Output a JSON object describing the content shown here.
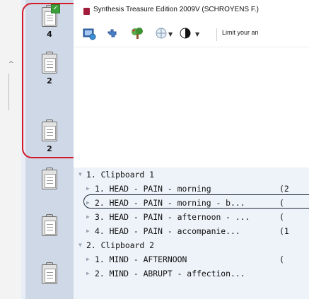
{
  "window": {
    "title": "Synthesis Treasure Edition 2009V (SCHROYENS F.)"
  },
  "toolbar": {
    "limit_text": "Limit your an",
    "icons": [
      "screen-icon",
      "puzzle-icon",
      "tree-icon",
      "globe-icon",
      "half-moon-icon"
    ]
  },
  "clipboards": [
    {
      "count": "4",
      "icon": "clipboard-checked-icon"
    },
    {
      "count": "2",
      "icon": "clipboard-icon"
    },
    {
      "count": "2",
      "icon": "clipboard-icon"
    },
    {
      "count": "",
      "icon": "clipboard-icon"
    },
    {
      "count": "",
      "icon": "clipboard-icon"
    },
    {
      "count": "",
      "icon": "clipboard-icon"
    }
  ],
  "tree": {
    "groups": [
      {
        "label": "1. Clipboard 1",
        "items": [
          {
            "label": "1. HEAD - PAIN - morning",
            "count": "(2"
          },
          {
            "label": "2. HEAD - PAIN - morning - b...",
            "count": "("
          },
          {
            "label": "3. HEAD - PAIN - afternoon - ...",
            "count": "("
          },
          {
            "label": "4. HEAD - PAIN - accompanie...",
            "count": "(1"
          }
        ]
      },
      {
        "label": "2. Clipboard 2",
        "items": [
          {
            "label": "1. MIND - AFTERNOON",
            "count": "("
          },
          {
            "label": "2. MIND - ABRUPT - affection...",
            "count": ""
          }
        ]
      }
    ]
  },
  "colors": {
    "highlight_outline": "#d31b2a",
    "clip_bar": "#cfd8e6",
    "tree_bg": "#eef3f9",
    "check_green": "#3aa03a"
  }
}
